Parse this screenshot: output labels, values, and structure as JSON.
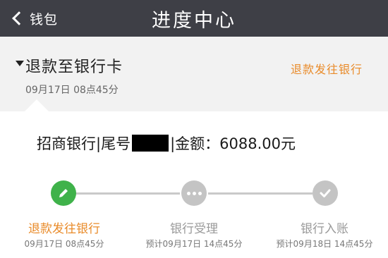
{
  "nav": {
    "back_label": "钱包",
    "title": "进度中心"
  },
  "refund": {
    "title": "退款至银行卡",
    "time": "09月17日 08点45分",
    "status": "退款发往银行"
  },
  "bank": {
    "prefix": "招商银行|尾号",
    "suffix": "|金额：",
    "amount": "6088.00元"
  },
  "steps": [
    {
      "label": "退款发往银行",
      "time": "09月17日 08点45分",
      "state": "done",
      "icon": "pencil-icon"
    },
    {
      "label": "银行受理",
      "time": "预计09月17日 14点45分",
      "state": "pending",
      "icon": "more-dots-icon"
    },
    {
      "label": "银行入账",
      "time": "预计09月18日 14点45分",
      "state": "pending",
      "icon": "check-icon"
    }
  ],
  "colors": {
    "navbar": "#3e3f46",
    "accent": "#e98b2a",
    "done": "#3fb24a",
    "pending": "#c4c4c4"
  }
}
